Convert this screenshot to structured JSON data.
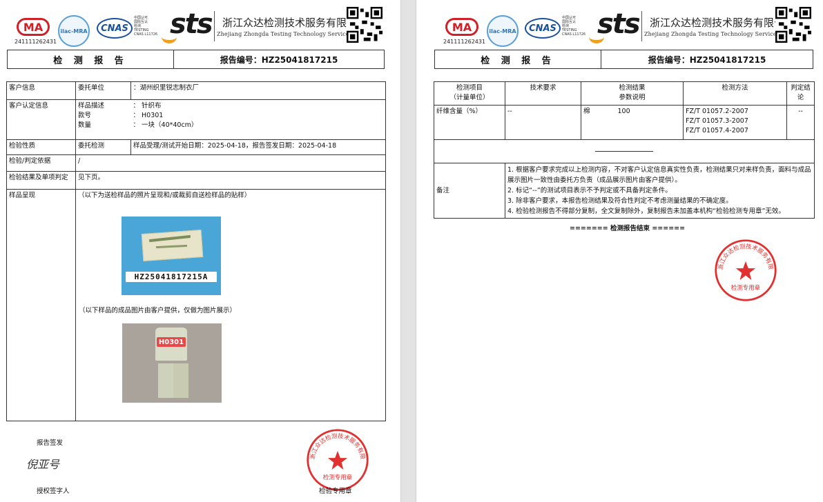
{
  "header": {
    "ma_number": "241111262431",
    "ilac_label": "ilac-MRA",
    "cnas_label": "CNAS",
    "cnas_small_lines": [
      "中国认可",
      "国际互认",
      "检测",
      "TESTING",
      "CNAS L11726"
    ],
    "sts_label": "sts",
    "company_cn": "浙江众达检测技术服务有限公司",
    "company_en": "Zhejiang Zhongda Testing Technology Service Co.,Ltd"
  },
  "title": {
    "doc_title": "检 测 报 告",
    "report_no": "报告编号：HZ25041817215"
  },
  "page1": {
    "client_info_label": "客户信息",
    "entrust_label": "委托单位",
    "entrust_value": "：湖州织里锐志制衣厂",
    "client_confirmed_label": "客户认定信息",
    "sample_desc_label": "样品描述",
    "sample_desc_value": "：  针织布",
    "style_label": "款号",
    "style_value": "：  H0301",
    "qty_label": "数量",
    "qty_value": "：  一块（40*40cm）",
    "test_nature_label": "检验性质",
    "test_nature_value": "委托检测",
    "dates_text": "样品受理/测试开始日期：2025-04-18，报告签发日期：2025-04-18",
    "basis_label": "检验/判定依据",
    "basis_value": "/",
    "result_label": "检验结果及单项判定",
    "result_value": "见下页。",
    "sample_show_label": "样品呈现",
    "sample_note1": "（以下为送检样品的照片呈现和/或裁剪自送检样品的贴样）",
    "sample_barcode": "HZ25041817215A",
    "sample_note2": "（以下样品的成品图片由客户提供，仅做为图片展示）",
    "product_tag": "H0301",
    "issuer_label": "报告签发",
    "signature": "倪亚号",
    "signer_label": "授权签字人",
    "stamp_ring": "浙江众达检测技术服务有限公司",
    "stamp_center": "检测专用章",
    "stamp_below": "检验专用章"
  },
  "page2": {
    "col_item": "检测项目",
    "col_item_unit": "（计量单位）",
    "col_requirement": "技术要求",
    "col_result": "检测结果",
    "col_result_sub": "参数说明",
    "col_method": "检测方法",
    "col_judge": "判定结论",
    "row_item": "纤维含量（%）",
    "row_requirement": "--",
    "row_param": "棉",
    "row_value": "100",
    "row_methods": [
      "FZ/T 01057.2-2007",
      "FZ/T 01057.3-2007",
      "FZ/T 01057.4-2007"
    ],
    "row_judge": "--",
    "remarks_label": "备注",
    "remarks": [
      "1.   根据客户要求完成以上检测内容，不对客户认定信息真实性负责，检测结果只对来样负责，面料与成品展示图片一致性由委托方负责（成品展示图片由客户提供）。",
      "2.   标记“--”的测试项目表示不予判定或不具备判定条件。",
      "3.   除非客户要求，本报告检测结果及符合性判定不考虑测量结果的不确定度。",
      "4.   检验检测报告不得部分复制，全文复制除外，复制报告未加盖本机构“检验检测专用章”无效。"
    ],
    "end_text": "======= 检测报告结束 ======",
    "stamp_ring": "浙江众达检测技术服务有限公司",
    "stamp_center": "检测专用章"
  }
}
